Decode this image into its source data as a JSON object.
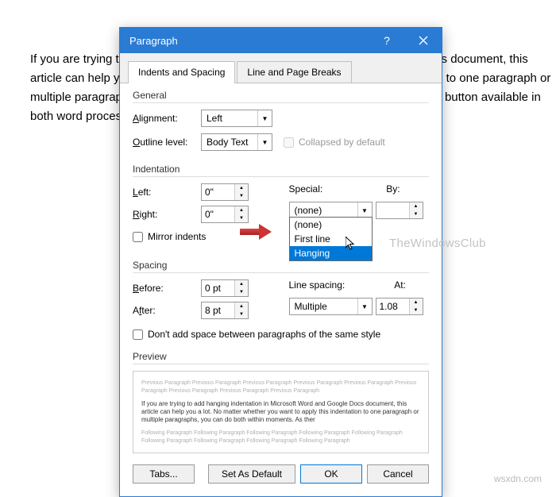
{
  "background_text": "If you are trying to add hanging indentation in Microsoft Word and Google Docs document, this article can help you a lot. No matter whether you want to apply this indentation to one paragraph or multiple paragraphs, you can do both within moments. As there is no one-click button available in both word processing software, you might need to check out the steps here.",
  "dialog": {
    "title": "Paragraph",
    "tabs": [
      "Indents and Spacing",
      "Line and Page Breaks"
    ],
    "general": {
      "title": "General",
      "alignment_label": "Alignment:",
      "alignment_value": "Left",
      "outline_label": "Outline level:",
      "outline_value": "Body Text",
      "collapsed_label": "Collapsed by default"
    },
    "indentation": {
      "title": "Indentation",
      "left_label": "Left:",
      "left_value": "0\"",
      "right_label": "Right:",
      "right_value": "0\"",
      "special_label": "Special:",
      "special_value": "(none)",
      "by_label": "By:",
      "by_value": "",
      "mirror_label": "Mirror indents",
      "options": [
        "(none)",
        "First line",
        "Hanging"
      ]
    },
    "spacing": {
      "title": "Spacing",
      "before_label": "Before:",
      "before_value": "0 pt",
      "after_label": "After:",
      "after_value": "8 pt",
      "line_label": "Line spacing:",
      "line_value": "Multiple",
      "at_label": "At:",
      "at_value": "1.08",
      "noadd_label": "Don't add space between paragraphs of the same style"
    },
    "preview": {
      "title": "Preview",
      "gray_before": "Previous Paragraph Previous Paragraph Previous Paragraph Previous Paragraph Previous Paragraph Previous Paragraph Previous Paragraph Previous Paragraph Previous Paragraph",
      "main": "If you are trying to add hanging indentation in Microsoft Word and Google Docs document, this article can help you a lot. No matter whether you want to apply this indentation to one paragraph or multiple paragraphs, you can do both within moments. As ther",
      "gray_after": "Following Paragraph Following Paragraph Following Paragraph Following Paragraph Following Paragraph Following Paragraph Following Paragraph Following Paragraph Following Paragraph"
    },
    "buttons": {
      "tabs": "Tabs...",
      "default": "Set As Default",
      "ok": "OK",
      "cancel": "Cancel"
    }
  },
  "watermark": "TheWindowsClub",
  "wsxd": "wsxdn.com"
}
